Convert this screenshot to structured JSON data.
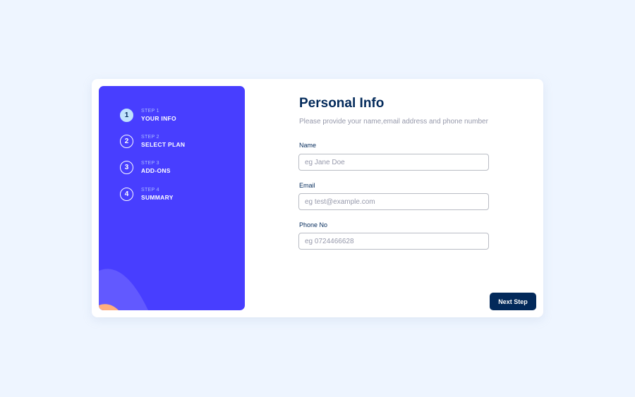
{
  "sidebar": {
    "steps": [
      {
        "number": "1",
        "caption": "STEP 1",
        "title": "YOUR INFO",
        "active": true
      },
      {
        "number": "2",
        "caption": "STEP 2",
        "title": "SELECT PLAN",
        "active": false
      },
      {
        "number": "3",
        "caption": "STEP 3",
        "title": "ADD-ONS",
        "active": false
      },
      {
        "number": "4",
        "caption": "STEP 4",
        "title": "SUMMARY",
        "active": false
      }
    ]
  },
  "form": {
    "title": "Personal Info",
    "subtitle": "Please provide your name,email address and phone number",
    "fields": {
      "name": {
        "label": "Name",
        "placeholder": "eg Jane Doe",
        "value": ""
      },
      "email": {
        "label": "Email",
        "placeholder": "eg test@example.com",
        "value": ""
      },
      "phone": {
        "label": "Phone No",
        "placeholder": "eg 0724466628",
        "value": ""
      }
    },
    "next_label": "Next Step"
  },
  "colors": {
    "page_background": "#eef5ff",
    "sidebar_background": "#483eff",
    "active_step": "#bfe2fd",
    "primary_text": "#02295a",
    "muted_text": "#9699ab",
    "decor_purple": "#6259ff",
    "decor_orange": "#ffaf7e"
  }
}
